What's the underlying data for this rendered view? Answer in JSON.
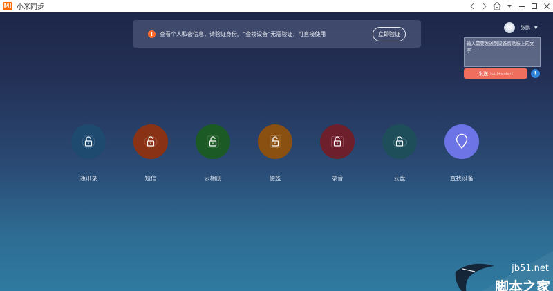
{
  "window": {
    "logo": "MI",
    "title": "小米同步",
    "controls": [
      "back-icon",
      "forward-icon",
      "home-icon",
      "minimize-icon",
      "maximize-icon",
      "close-icon"
    ]
  },
  "banner": {
    "icon": "warning-icon",
    "text": "查看个人私密信息，请验证身份。“查找设备”无需验证，可直接使用",
    "button": "立即验证"
  },
  "user": {
    "name": "张鹏",
    "caret": "▼"
  },
  "clipboard": {
    "placeholder": "输入需要发送到设备剪贴板上的文字",
    "send_label": "发送",
    "send_hint": "[ctrl+enter]",
    "info": "!"
  },
  "apps": [
    {
      "label": "通讯录",
      "color": "#1f4a70",
      "icon": "lock-icon"
    },
    {
      "label": "短信",
      "color": "#8a3215",
      "icon": "lock-icon"
    },
    {
      "label": "云相册",
      "color": "#1c5a25",
      "icon": "lock-icon"
    },
    {
      "label": "便签",
      "color": "#8a5012",
      "icon": "lock-icon"
    },
    {
      "label": "录音",
      "color": "#6e1f2c",
      "icon": "lock-icon"
    },
    {
      "label": "云盘",
      "color": "#1e4e5a",
      "icon": "lock-icon"
    },
    {
      "label": "查找设备",
      "color": "#6d74e6",
      "icon": "location-pin-icon"
    }
  ],
  "watermark": {
    "site": "jb51.net",
    "name": "脚本之家"
  }
}
